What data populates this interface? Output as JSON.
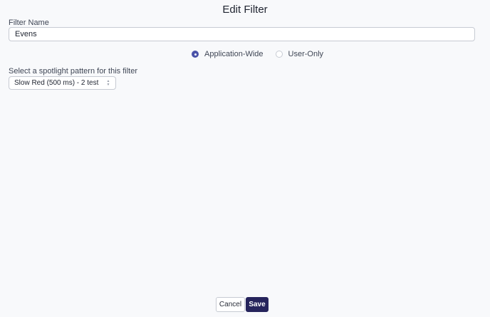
{
  "dialog": {
    "title": "Edit Filter"
  },
  "filter_name": {
    "label": "Filter Name",
    "value": "Evens"
  },
  "scope": {
    "options": [
      {
        "label": "Application-Wide",
        "selected": true
      },
      {
        "label": "User-Only",
        "selected": false
      }
    ]
  },
  "pattern": {
    "label": "Select a spotlight pattern for this filter",
    "selected_value": "Slow Red (500 ms) - 2 test"
  },
  "actions": {
    "cancel_label": "Cancel",
    "save_label": "Save"
  },
  "colors": {
    "accent": "#4a52a8",
    "primary_button": "#26245c",
    "background": "#f8f9fb"
  },
  "icons": {
    "select_arrows": "chevron-up-down-icon"
  }
}
